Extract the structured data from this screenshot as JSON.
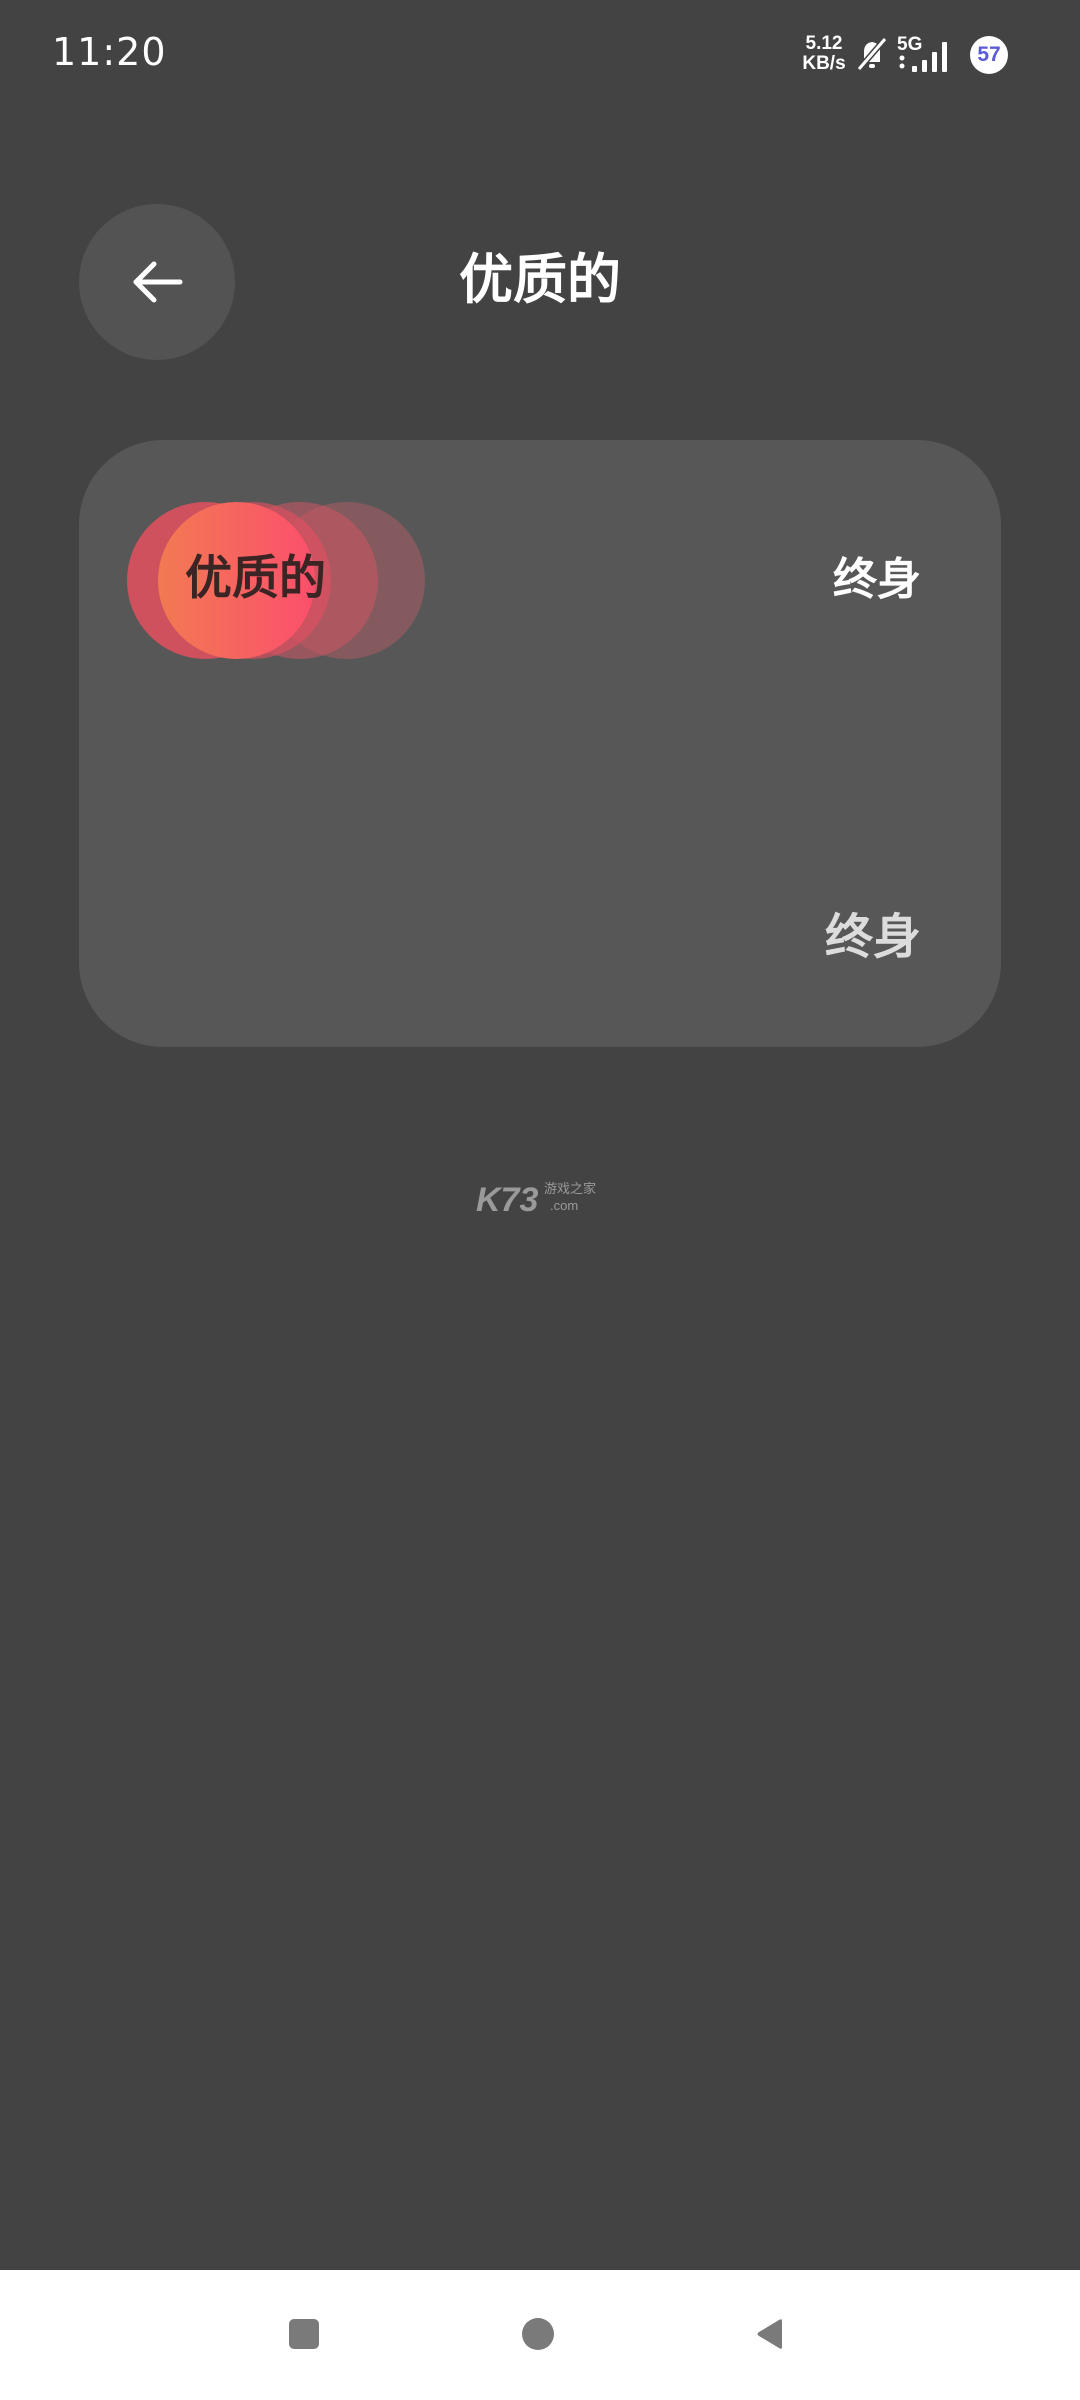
{
  "status_bar": {
    "time": "11:20",
    "net_speed_value": "5.12",
    "net_speed_unit": "KB/s",
    "network_type": "5G",
    "battery": "57",
    "icons": [
      "bell-mute-icon",
      "signal-icon"
    ]
  },
  "header": {
    "title": "优质的",
    "back_icon": "arrow-left-icon"
  },
  "widget": {
    "label": "优质的",
    "duration_top": "终身",
    "duration_bottom": "终身"
  },
  "watermark": {
    "main": "K73",
    "cn": "游戏之家",
    "com": ".com"
  },
  "nav_bar": {
    "icons": [
      "recents-icon",
      "home-icon",
      "back-triangle-icon"
    ]
  },
  "colors": {
    "background": "#434343",
    "card": "#575757",
    "back_button": "#535353",
    "accent_gradient_start": "#f27a52",
    "accent_gradient_end": "#fb4f6c",
    "battery_text": "#5b5bd6"
  }
}
